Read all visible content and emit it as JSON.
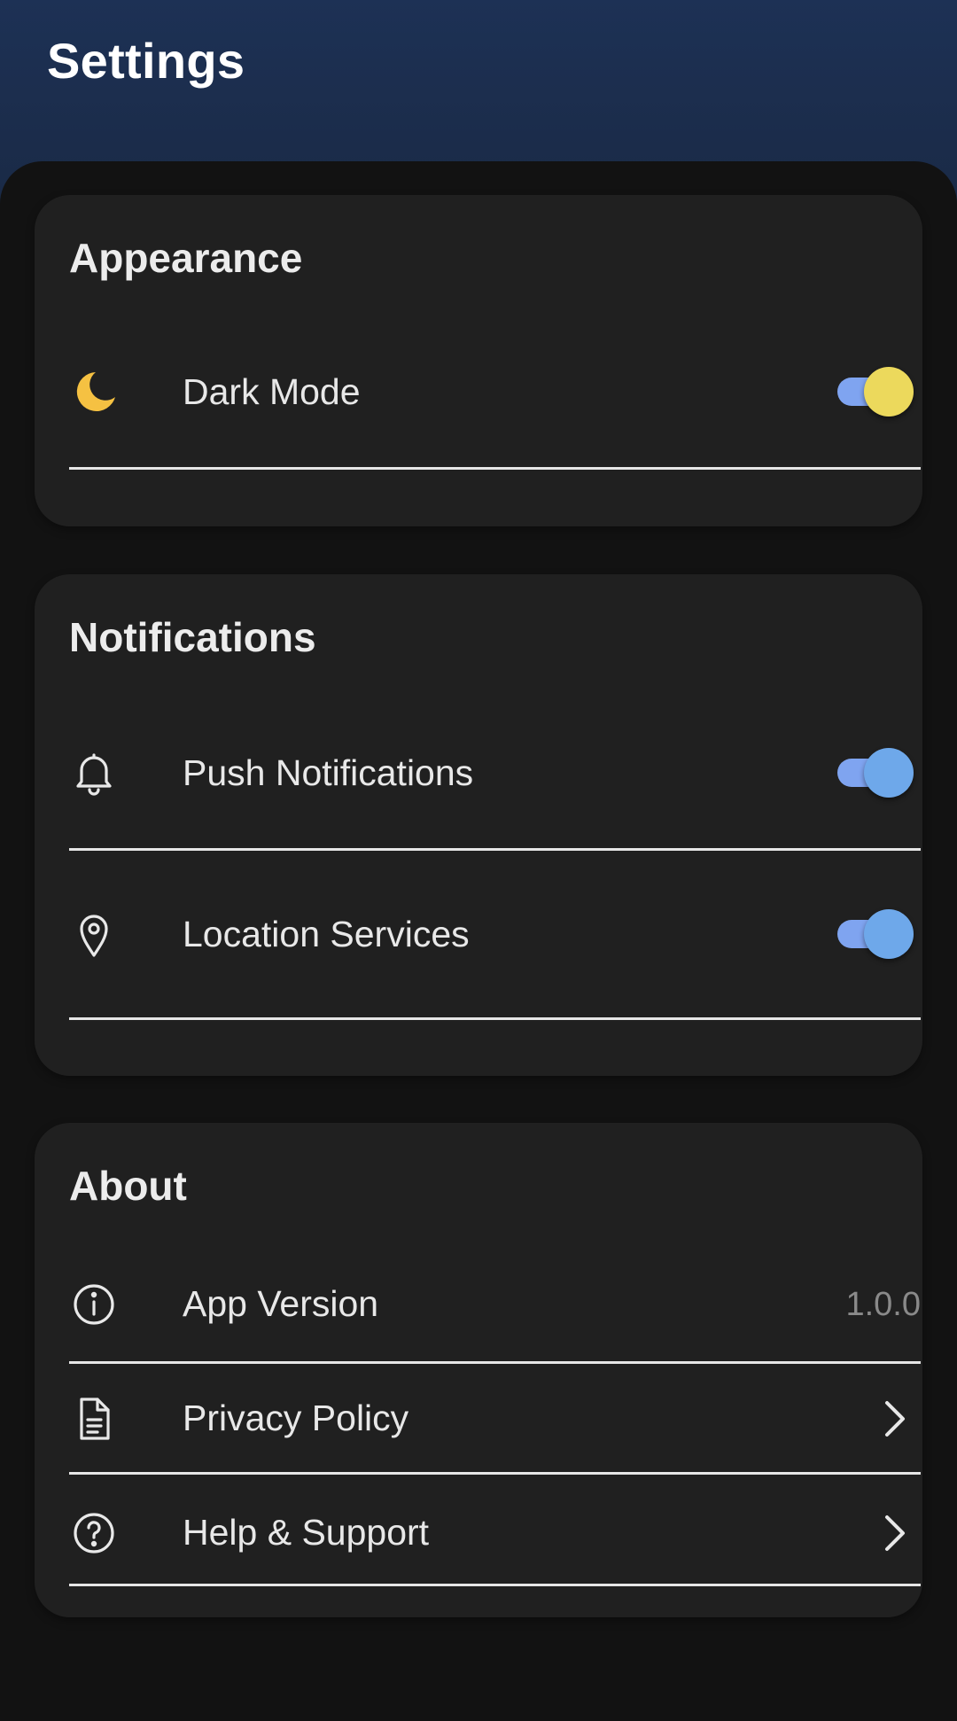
{
  "header": {
    "title": "Settings"
  },
  "appearance": {
    "title": "Appearance",
    "dark_mode": {
      "label": "Dark Mode",
      "enabled": true,
      "icon": "moon-icon"
    }
  },
  "notifications": {
    "title": "Notifications",
    "push": {
      "label": "Push Notifications",
      "enabled": true,
      "icon": "bell-icon"
    },
    "location": {
      "label": "Location Services",
      "enabled": true,
      "icon": "location-pin-icon"
    }
  },
  "about": {
    "title": "About",
    "version": {
      "label": "App Version",
      "value": "1.0.0",
      "icon": "info-icon"
    },
    "privacy": {
      "label": "Privacy Policy",
      "icon": "document-icon"
    },
    "help": {
      "label": "Help & Support",
      "icon": "help-circle-icon"
    }
  },
  "colors": {
    "header": "#1d3155",
    "background": "#121212",
    "card": "#202020",
    "toggle_track": "#7fa4f0",
    "dark_mode_knob": "#ecd95c",
    "blue_knob": "#6ea8ea",
    "moon": "#f5c142"
  }
}
